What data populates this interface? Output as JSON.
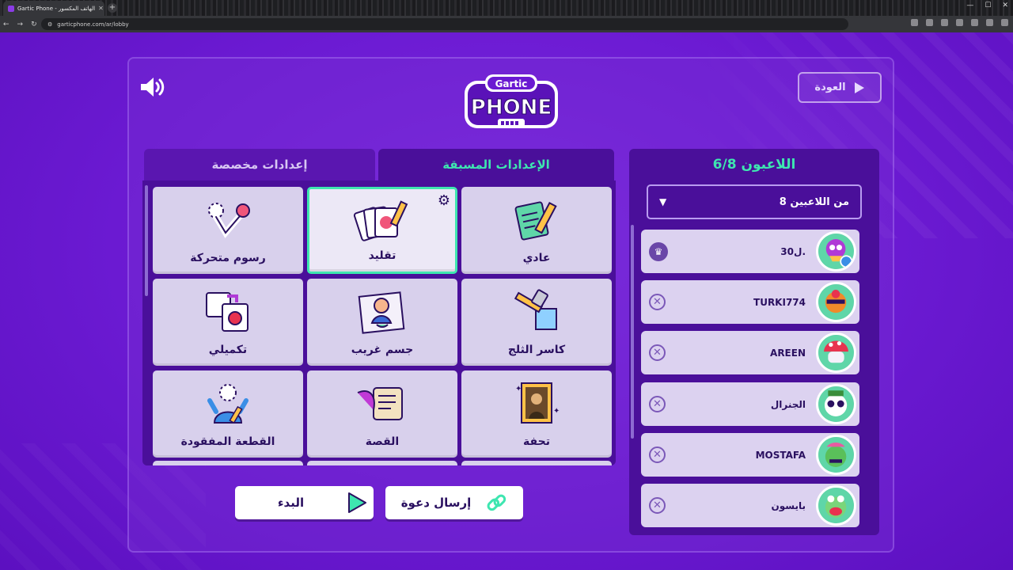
{
  "browser": {
    "tab_title": "Gartic Phone - الهاتف المكسور",
    "url": "garticphone.com/ar/lobby"
  },
  "header": {
    "back_label": "العودة",
    "logo_top": "Gartic",
    "logo_main": "PHONE"
  },
  "modes": {
    "tab_preset": "الإعدادات المسبقة",
    "tab_custom": "إعدادات مخصصة",
    "items": [
      {
        "label": "عادي",
        "icon": "notepad-pencil-icon"
      },
      {
        "label": "تقليد",
        "icon": "cards-pencil-icon",
        "selected": true
      },
      {
        "label": "رسوم متحركة",
        "icon": "animation-icon"
      },
      {
        "label": "كاسر الثلج",
        "icon": "ice-hammer-icon"
      },
      {
        "label": "جسم غريب",
        "icon": "strange-body-icon"
      },
      {
        "label": "تكميلي",
        "icon": "puzzle-apple-icon"
      },
      {
        "label": "تحفة",
        "icon": "mona-lisa-icon"
      },
      {
        "label": "القصة",
        "icon": "scroll-quill-icon"
      },
      {
        "label": "القطعة المفقودة",
        "icon": "missing-piece-icon"
      }
    ]
  },
  "players": {
    "title": "اللاعبون 6/8",
    "dropdown_value": "8 من اللاعبين",
    "list": [
      {
        "name": "3ل0.",
        "role": "host"
      },
      {
        "name": "TURKI774",
        "role": "player"
      },
      {
        "name": "AREEN",
        "role": "player"
      },
      {
        "name": "الجنرال",
        "role": "player"
      },
      {
        "name": "MOSTAFA",
        "role": "player"
      },
      {
        "name": "بايسون",
        "role": "player"
      }
    ]
  },
  "actions": {
    "start_label": "البدء",
    "invite_label": "إرسال دعوة"
  },
  "colors": {
    "background": "#6b1ad2",
    "panel_dark": "#4a0f9a",
    "accent_green": "#3ee6b0",
    "card": "#d8d0ec"
  }
}
